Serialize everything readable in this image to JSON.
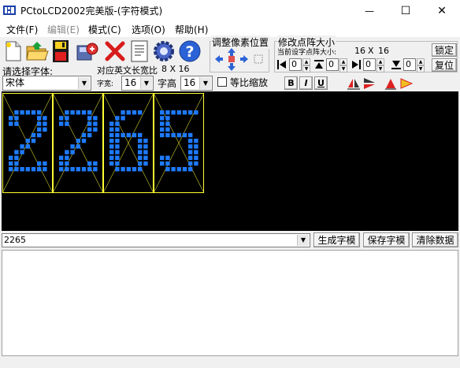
{
  "window": {
    "title": "PCtoLCD2002完美版-(字符模式)",
    "minimize_glyph": "—",
    "maximize_glyph": "☐",
    "close_glyph": "✕"
  },
  "menu": [
    {
      "label": "文件(F)",
      "enabled": true
    },
    {
      "label": "编辑(E)",
      "enabled": false
    },
    {
      "label": "模式(C)",
      "enabled": true
    },
    {
      "label": "选项(O)",
      "enabled": true
    },
    {
      "label": "帮助(H)",
      "enabled": true
    }
  ],
  "toolbar": {
    "icons": [
      "new-file-icon",
      "open-folder-icon",
      "save-disk-icon",
      "export-icon",
      "delete-x-icon",
      "notes-icon",
      "gear-icon",
      "help-icon"
    ],
    "help_glyph": "?",
    "adjust_group_label": "调整像素位置",
    "resize_group_label": "修改点阵大小",
    "current_size_label": "当前设字点阵大小:",
    "current_size_w": "16",
    "current_size_x": "X",
    "current_size_h": "16",
    "lock_label": "锁定",
    "restore_label": "复位",
    "spinners": [
      "0",
      "0",
      "0",
      "0"
    ]
  },
  "font_row": {
    "select_font_label": "请选择字体:",
    "font_value": "宋体",
    "eng_width_label": "对应英文长宽比",
    "eng_width_value": "8 X 16",
    "char_width_label": "字宽:",
    "char_width_value": "16",
    "char_height_label": "字高",
    "char_height_value": "16",
    "proportional_label": "等比缩放",
    "bold_label": "B",
    "italic_label": "I",
    "underline_label": "U"
  },
  "preview": {
    "characters": [
      "2",
      "2",
      "6",
      "5"
    ],
    "dot_color": "#1e7bff",
    "frame_color": "#ffff33",
    "background": "#000000"
  },
  "input": {
    "text": "2265",
    "generate_label": "生成字模",
    "save_label": "保存字模",
    "clear_label": "清除数据"
  },
  "colors": {
    "chrome": "#f0f0f0",
    "canvas_bg": "#000000"
  }
}
